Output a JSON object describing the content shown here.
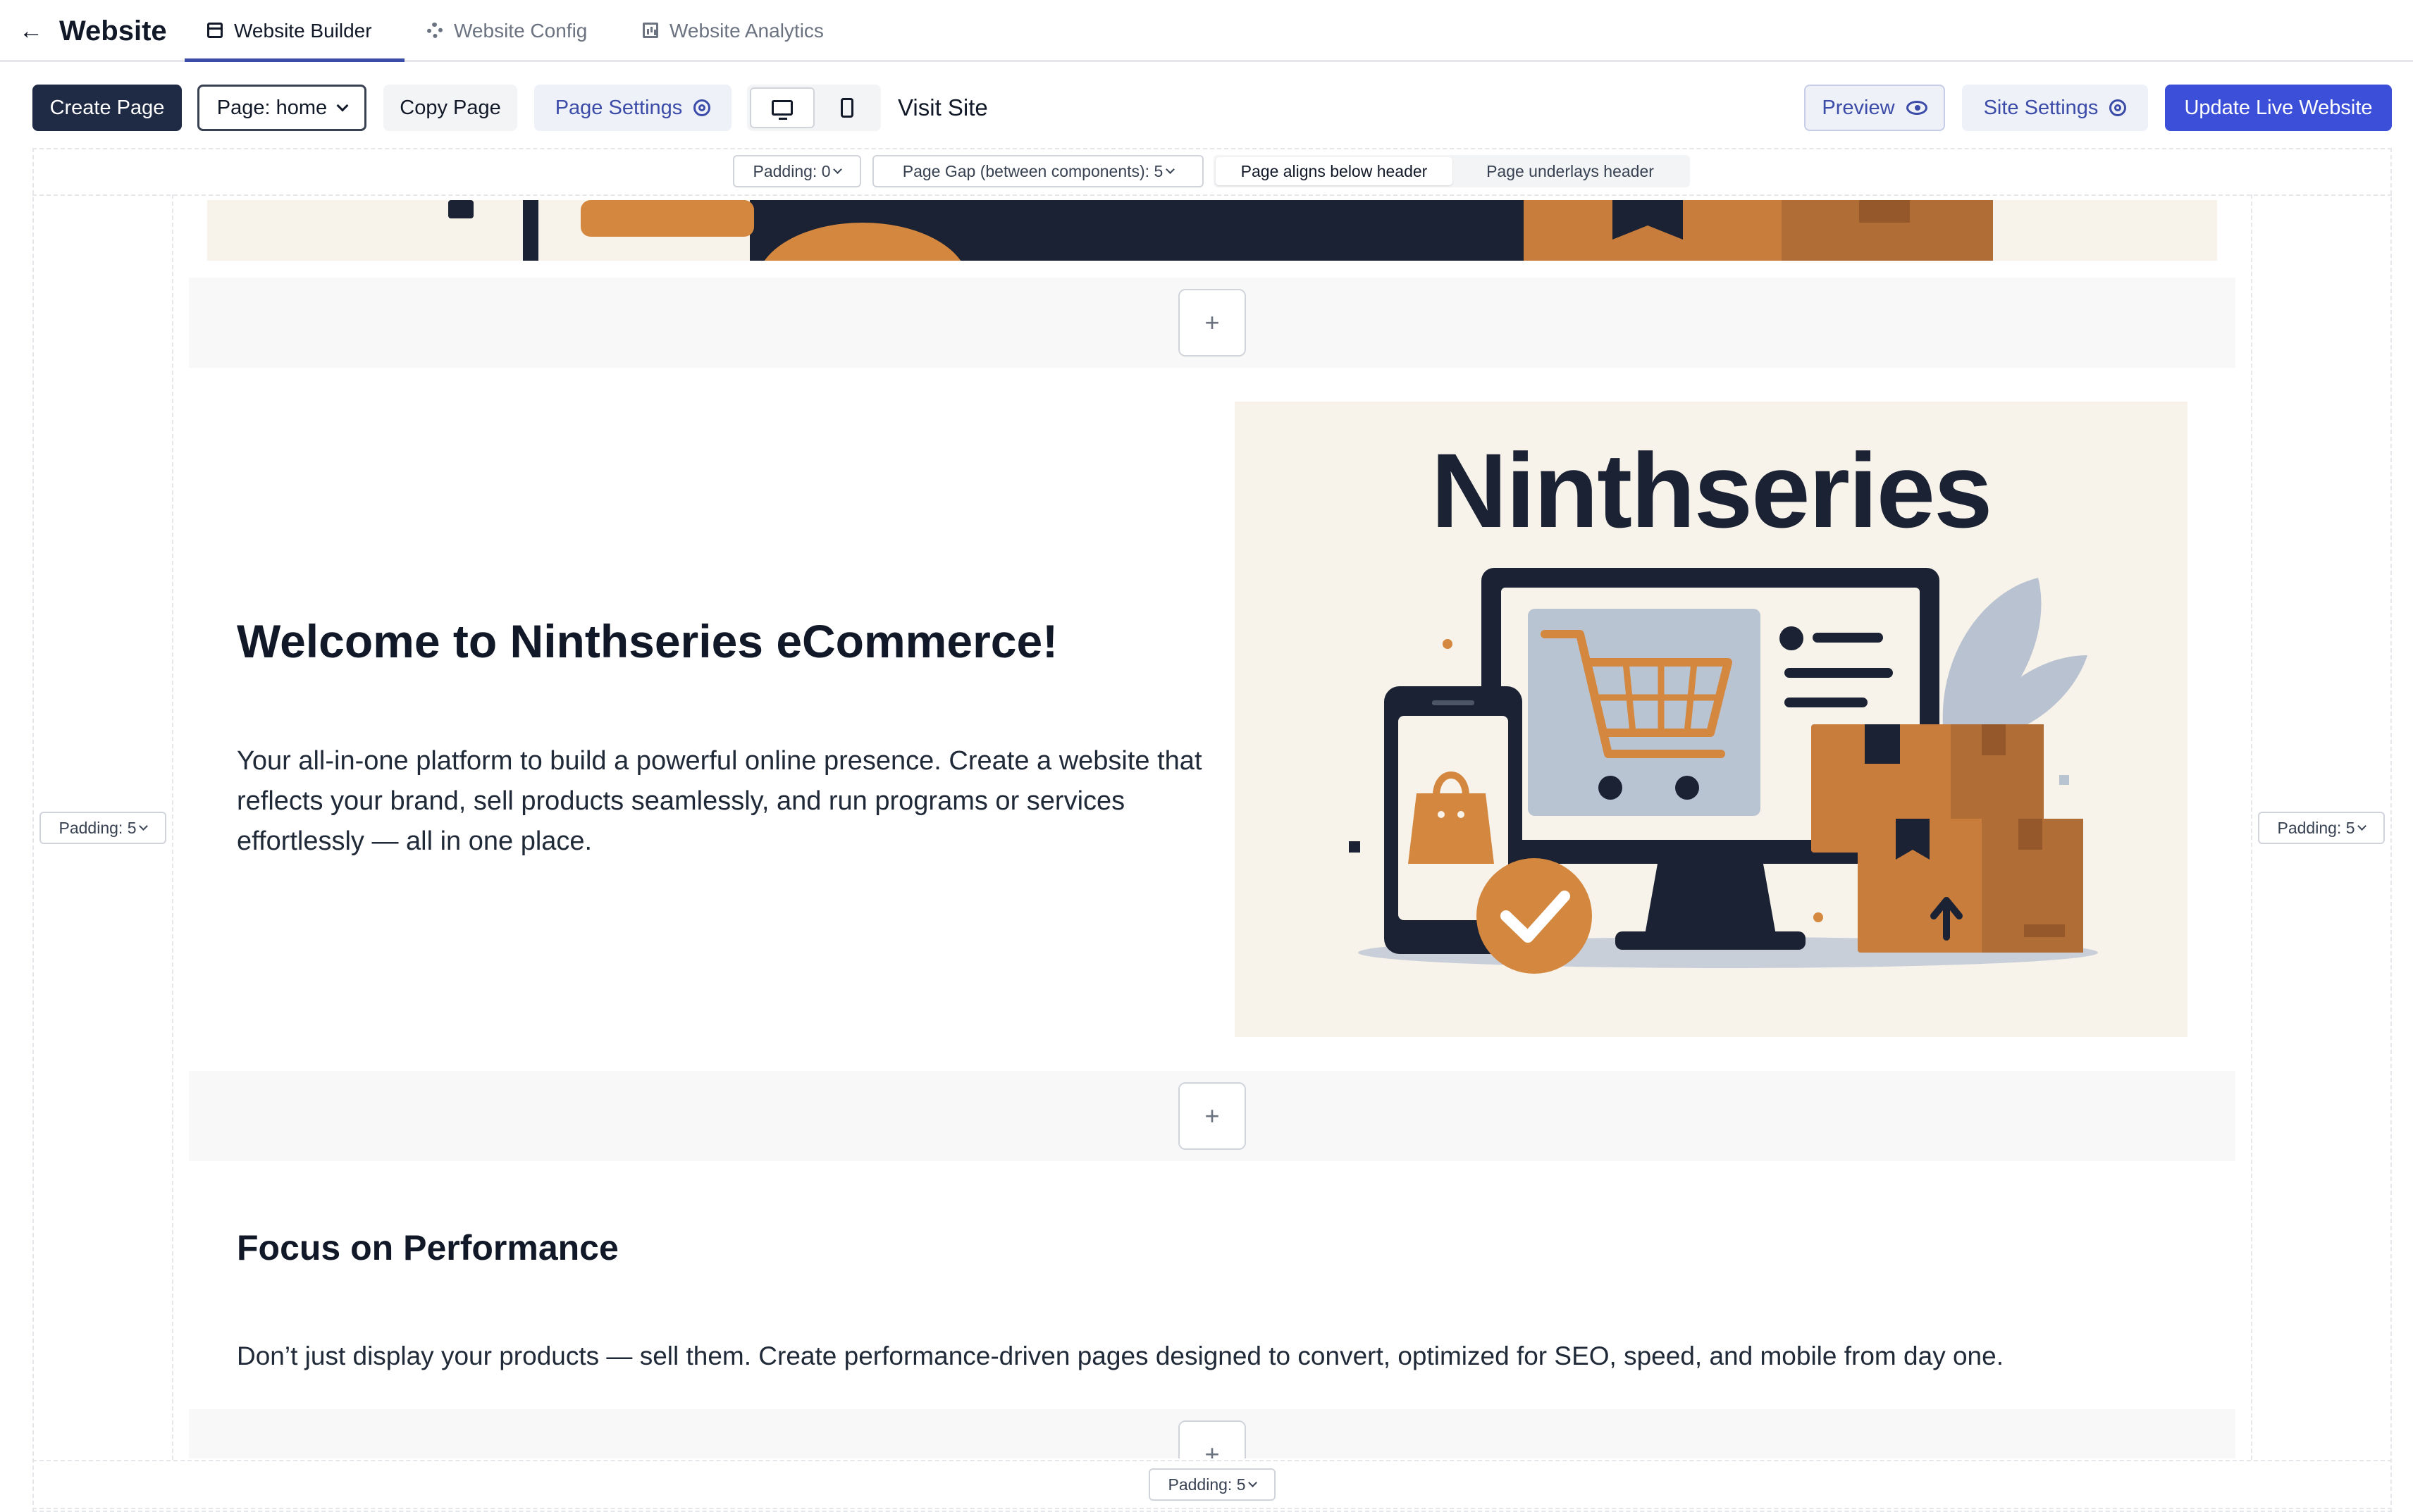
{
  "app": {
    "title": "Website"
  },
  "tabs": [
    {
      "label": "Website Builder",
      "active": true
    },
    {
      "label": "Website Config",
      "active": false
    },
    {
      "label": "Website Analytics",
      "active": false
    }
  ],
  "toolbar": {
    "create_page": "Create Page",
    "page_select": "Page: home",
    "copy_page": "Copy Page",
    "page_settings": "Page Settings",
    "visit_site": "Visit Site",
    "preview": "Preview",
    "site_settings": "Site Settings",
    "update_live": "Update Live Website",
    "devices": [
      "desktop",
      "mobile"
    ]
  },
  "page_controls": {
    "padding_top": "Padding: 0",
    "page_gap": "Page Gap (between components): 5",
    "align_below": "Page aligns below header",
    "align_under": "Page underlays header",
    "padding_left": "Padding: 5",
    "padding_right": "Padding: 5",
    "padding_bottom": "Padding: 5"
  },
  "content": {
    "hero": {
      "title": "Welcome to Ninthseries eCommerce!",
      "description": "Your all-in-one platform to build a powerful online presence. Create a website that reflects your brand, sell products seamlessly, and run programs or services effortlessly — all in one place.",
      "image_text": "Ninthseries"
    },
    "performance": {
      "title": "Focus on Performance",
      "description": "Don’t just display your products — sell them. Create performance-driven pages designed to convert, optimized for SEO, speed, and mobile from day one."
    },
    "add_label": "+"
  },
  "colors": {
    "primary_dark": "#1f2a44",
    "accent_blue": "#3b4fd8",
    "illustration_orange": "#d4883f",
    "illustration_navy": "#1a2234"
  }
}
